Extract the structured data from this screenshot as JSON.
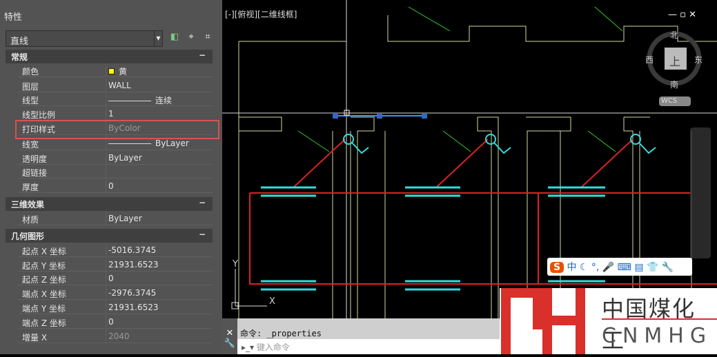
{
  "panel": {
    "title": "特性",
    "selection": "直线",
    "sections": {
      "general": "常规",
      "three_d": "三维效果",
      "geometry": "几何图形"
    },
    "general": [
      {
        "k": "颜色",
        "v": "黄"
      },
      {
        "k": "图层",
        "v": "WALL"
      },
      {
        "k": "线型",
        "v": "连续"
      },
      {
        "k": "线型比例",
        "v": "1"
      },
      {
        "k": "打印样式",
        "v": "ByColor"
      },
      {
        "k": "线宽",
        "v": "ByLayer"
      },
      {
        "k": "透明度",
        "v": "ByLayer"
      },
      {
        "k": "超链接",
        "v": ""
      },
      {
        "k": "厚度",
        "v": "0"
      }
    ],
    "three_d": [
      {
        "k": "材质",
        "v": "ByLayer"
      }
    ],
    "geometry": [
      {
        "k": "起点 X 坐标",
        "v": "-5016.3745"
      },
      {
        "k": "起点 Y 坐标",
        "v": "21931.6523"
      },
      {
        "k": "起点 Z 坐标",
        "v": "0"
      },
      {
        "k": "端点 X 坐标",
        "v": "-2976.3745"
      },
      {
        "k": "端点 Y 坐标",
        "v": "21931.6523"
      },
      {
        "k": "端点 Z 坐标",
        "v": "0"
      },
      {
        "k": "增量 X",
        "v": "2040"
      }
    ]
  },
  "viewport": {
    "label": "[-][俯视][二维线框]",
    "compass": {
      "n": "北",
      "s": "南",
      "e": "东",
      "w": "西",
      "top": "上"
    },
    "wcs": "WCS",
    "ucs_x": "X",
    "ucs_y": "Y"
  },
  "command": {
    "history": "命令: _properties",
    "placeholder": "键入命令"
  },
  "ime": {
    "s": "S",
    "lang": "中"
  },
  "logo": {
    "cn": "中国煤化工",
    "en": "CNMHG",
    "mark": "MH"
  }
}
